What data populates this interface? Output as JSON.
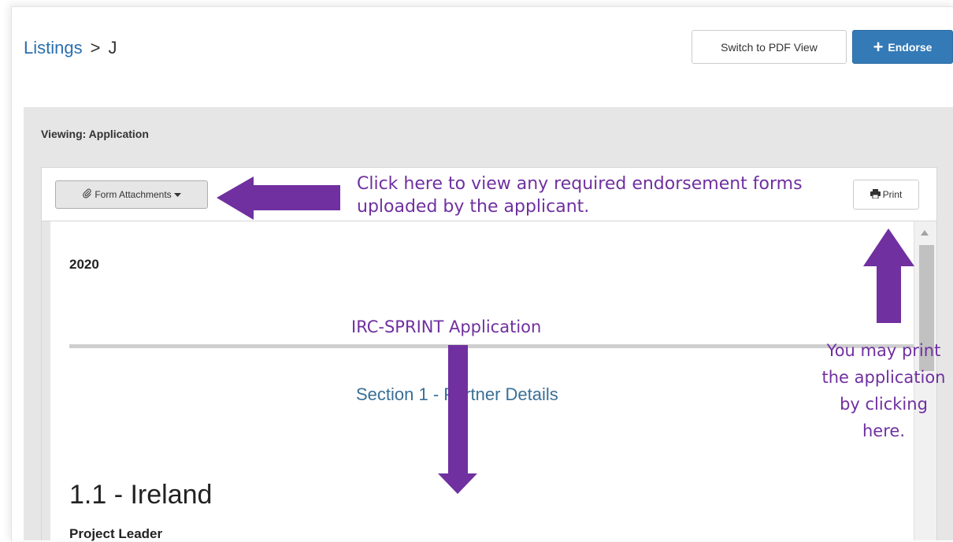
{
  "breadcrumb": {
    "root": "Listings",
    "separator": ">",
    "current": "J"
  },
  "header": {
    "pdf_button": "Switch to PDF View",
    "endorse_button": "Endorse"
  },
  "viewing_label": "Viewing: Application",
  "toolbar": {
    "attachments_button": "Form Attachments",
    "print_button": "Print"
  },
  "document": {
    "year": "2020",
    "section_title": "Section 1 - Partner Details",
    "subsection_title": "1.1 - Ireland",
    "role_label": "Project Leader"
  },
  "annotations": {
    "attachments_note": "Click here to view any required endorsement forms uploaded by the applicant.",
    "application_note": "IRC-SPRINT Application",
    "print_note": "You may print the application by clicking here."
  },
  "colors": {
    "annotation": "#7030a0",
    "primary": "#337ab7",
    "section_title": "#3a6f96"
  },
  "icons": {
    "attach": "paperclip-icon",
    "print": "printer-icon",
    "add": "plus-icon",
    "caret": "caret-down-icon"
  }
}
